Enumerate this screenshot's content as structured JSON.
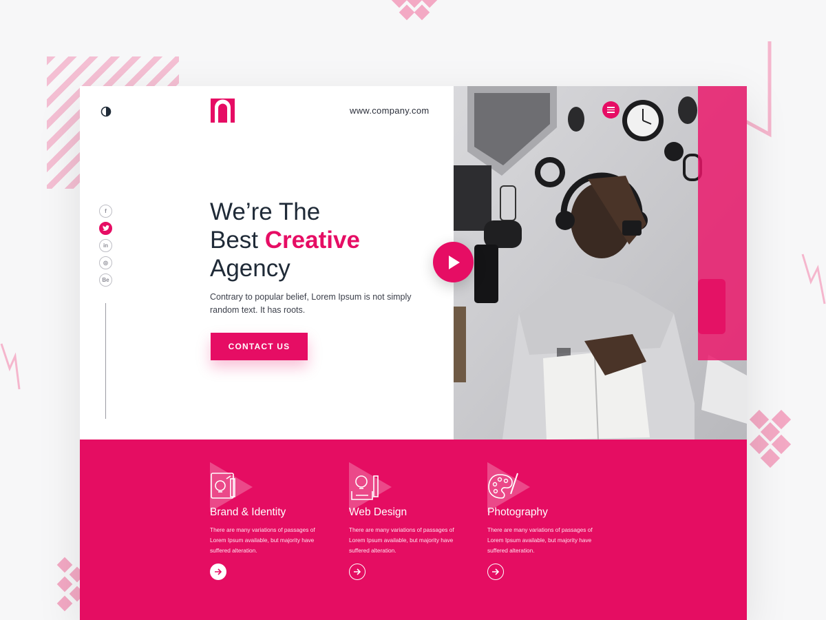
{
  "header": {
    "site_url": "www.company.com"
  },
  "social": [
    {
      "icon": "facebook-icon",
      "label": "f"
    },
    {
      "icon": "twitter-icon",
      "label": "t"
    },
    {
      "icon": "linkedin-icon",
      "label": "in"
    },
    {
      "icon": "dribbble-icon",
      "label": "◎"
    },
    {
      "icon": "behance-icon",
      "label": "Be"
    }
  ],
  "hero": {
    "headline_line1": "We’re The",
    "headline_line2_plain": "Best ",
    "headline_line2_accent": "Creative",
    "headline_line3": "Agency",
    "description": "Contrary to popular belief, Lorem Ipsum is not simply random text. It has roots.",
    "cta_label": "CONTACT US"
  },
  "services": [
    {
      "title": "Brand & Identity",
      "text": "There are many variations of passages of Lorem Ipsum available, but majority have suffered alteration.",
      "icon": "brand-identity-icon"
    },
    {
      "title": "Web Design",
      "text": "There are many variations of passages of Lorem Ipsum available, but majority have suffered alteration.",
      "icon": "web-design-icon"
    },
    {
      "title": "Photography",
      "text": "There are many variations of passages of Lorem Ipsum available, but majority have suffered alteration.",
      "icon": "photography-icon"
    }
  ],
  "colors": {
    "accent": "#e60d64",
    "dark_text": "#1f2a37",
    "background": "#f7f7f8"
  }
}
